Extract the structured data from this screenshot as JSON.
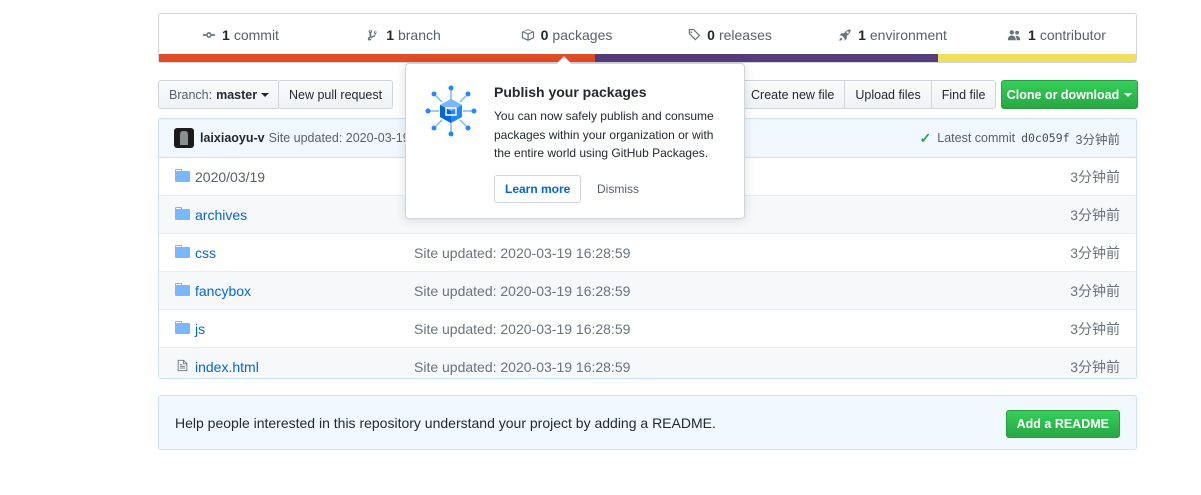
{
  "summary": {
    "commits": {
      "count": "1",
      "label": "commit",
      "icon": "commit-icon"
    },
    "branches": {
      "count": "1",
      "label": "branch",
      "icon": "branch-icon"
    },
    "packages": {
      "count": "0",
      "label": "packages",
      "icon": "package-icon"
    },
    "releases": {
      "count": "0",
      "label": "releases",
      "icon": "tag-icon"
    },
    "environments": {
      "count": "1",
      "label": "environment",
      "icon": "rocket-icon"
    },
    "contributors": {
      "count": "1",
      "label": "contributor",
      "icon": "people-icon"
    },
    "language_colors": [
      "#e34c26",
      "#563d7c",
      "#f1e05a"
    ]
  },
  "toolbar": {
    "branch_prefix": "Branch:",
    "branch_name": "master",
    "new_pull_request": "New pull request",
    "create_new_file": "Create new file",
    "upload_files": "Upload files",
    "find_file": "Find file",
    "clone_or_download": "Clone or download"
  },
  "commit": {
    "author": "laixiaoyu-v",
    "message": "Site updated: 2020-03-19 1",
    "latest_label": "Latest commit",
    "sha": "d0c059f",
    "age": "3分钟前"
  },
  "files": [
    {
      "name": "2020/03/19",
      "type": "folder",
      "message": "",
      "age": "3分钟前"
    },
    {
      "name": "archives",
      "type": "folder",
      "message": "",
      "age": "3分钟前"
    },
    {
      "name": "css",
      "type": "folder",
      "message": "Site updated: 2020-03-19 16:28:59",
      "age": "3分钟前"
    },
    {
      "name": "fancybox",
      "type": "folder",
      "message": "Site updated: 2020-03-19 16:28:59",
      "age": "3分钟前"
    },
    {
      "name": "js",
      "type": "folder",
      "message": "Site updated: 2020-03-19 16:28:59",
      "age": "3分钟前"
    },
    {
      "name": "index.html",
      "type": "file",
      "message": "Site updated: 2020-03-19 16:28:59",
      "age": "3分钟前"
    }
  ],
  "readme": {
    "text": "Help people interested in this repository understand your project by adding a README.",
    "button": "Add a README"
  },
  "popover": {
    "title": "Publish your packages",
    "body": "You can now safely publish and consume packages within your organization or with the entire world using GitHub Packages.",
    "learn_more": "Learn more",
    "dismiss": "Dismiss"
  }
}
